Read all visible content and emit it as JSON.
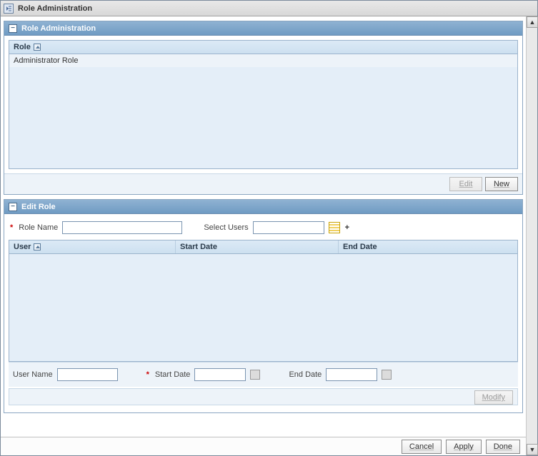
{
  "window": {
    "title": "Role Administration"
  },
  "panel1": {
    "title": "Role Administration",
    "columns": {
      "role": "Role"
    },
    "rows": [
      {
        "role": "Administrator Role"
      }
    ],
    "actions": {
      "edit": "Edit",
      "new": "New"
    }
  },
  "panel2": {
    "title": "Edit Role",
    "fields": {
      "role_name_label": "Role Name",
      "role_name_value": "",
      "select_users_label": "Select Users",
      "select_users_value": ""
    },
    "columns": {
      "user": "User",
      "start_date": "Start Date",
      "end_date": "End Date"
    },
    "bottom": {
      "user_name_label": "User Name",
      "user_name_value": "",
      "start_date_label": "Start Date",
      "start_date_value": "",
      "end_date_label": "End Date",
      "end_date_value": ""
    },
    "actions": {
      "modify": "Modify"
    }
  },
  "footer": {
    "cancel": "Cancel",
    "apply": "Apply",
    "done": "Done"
  }
}
